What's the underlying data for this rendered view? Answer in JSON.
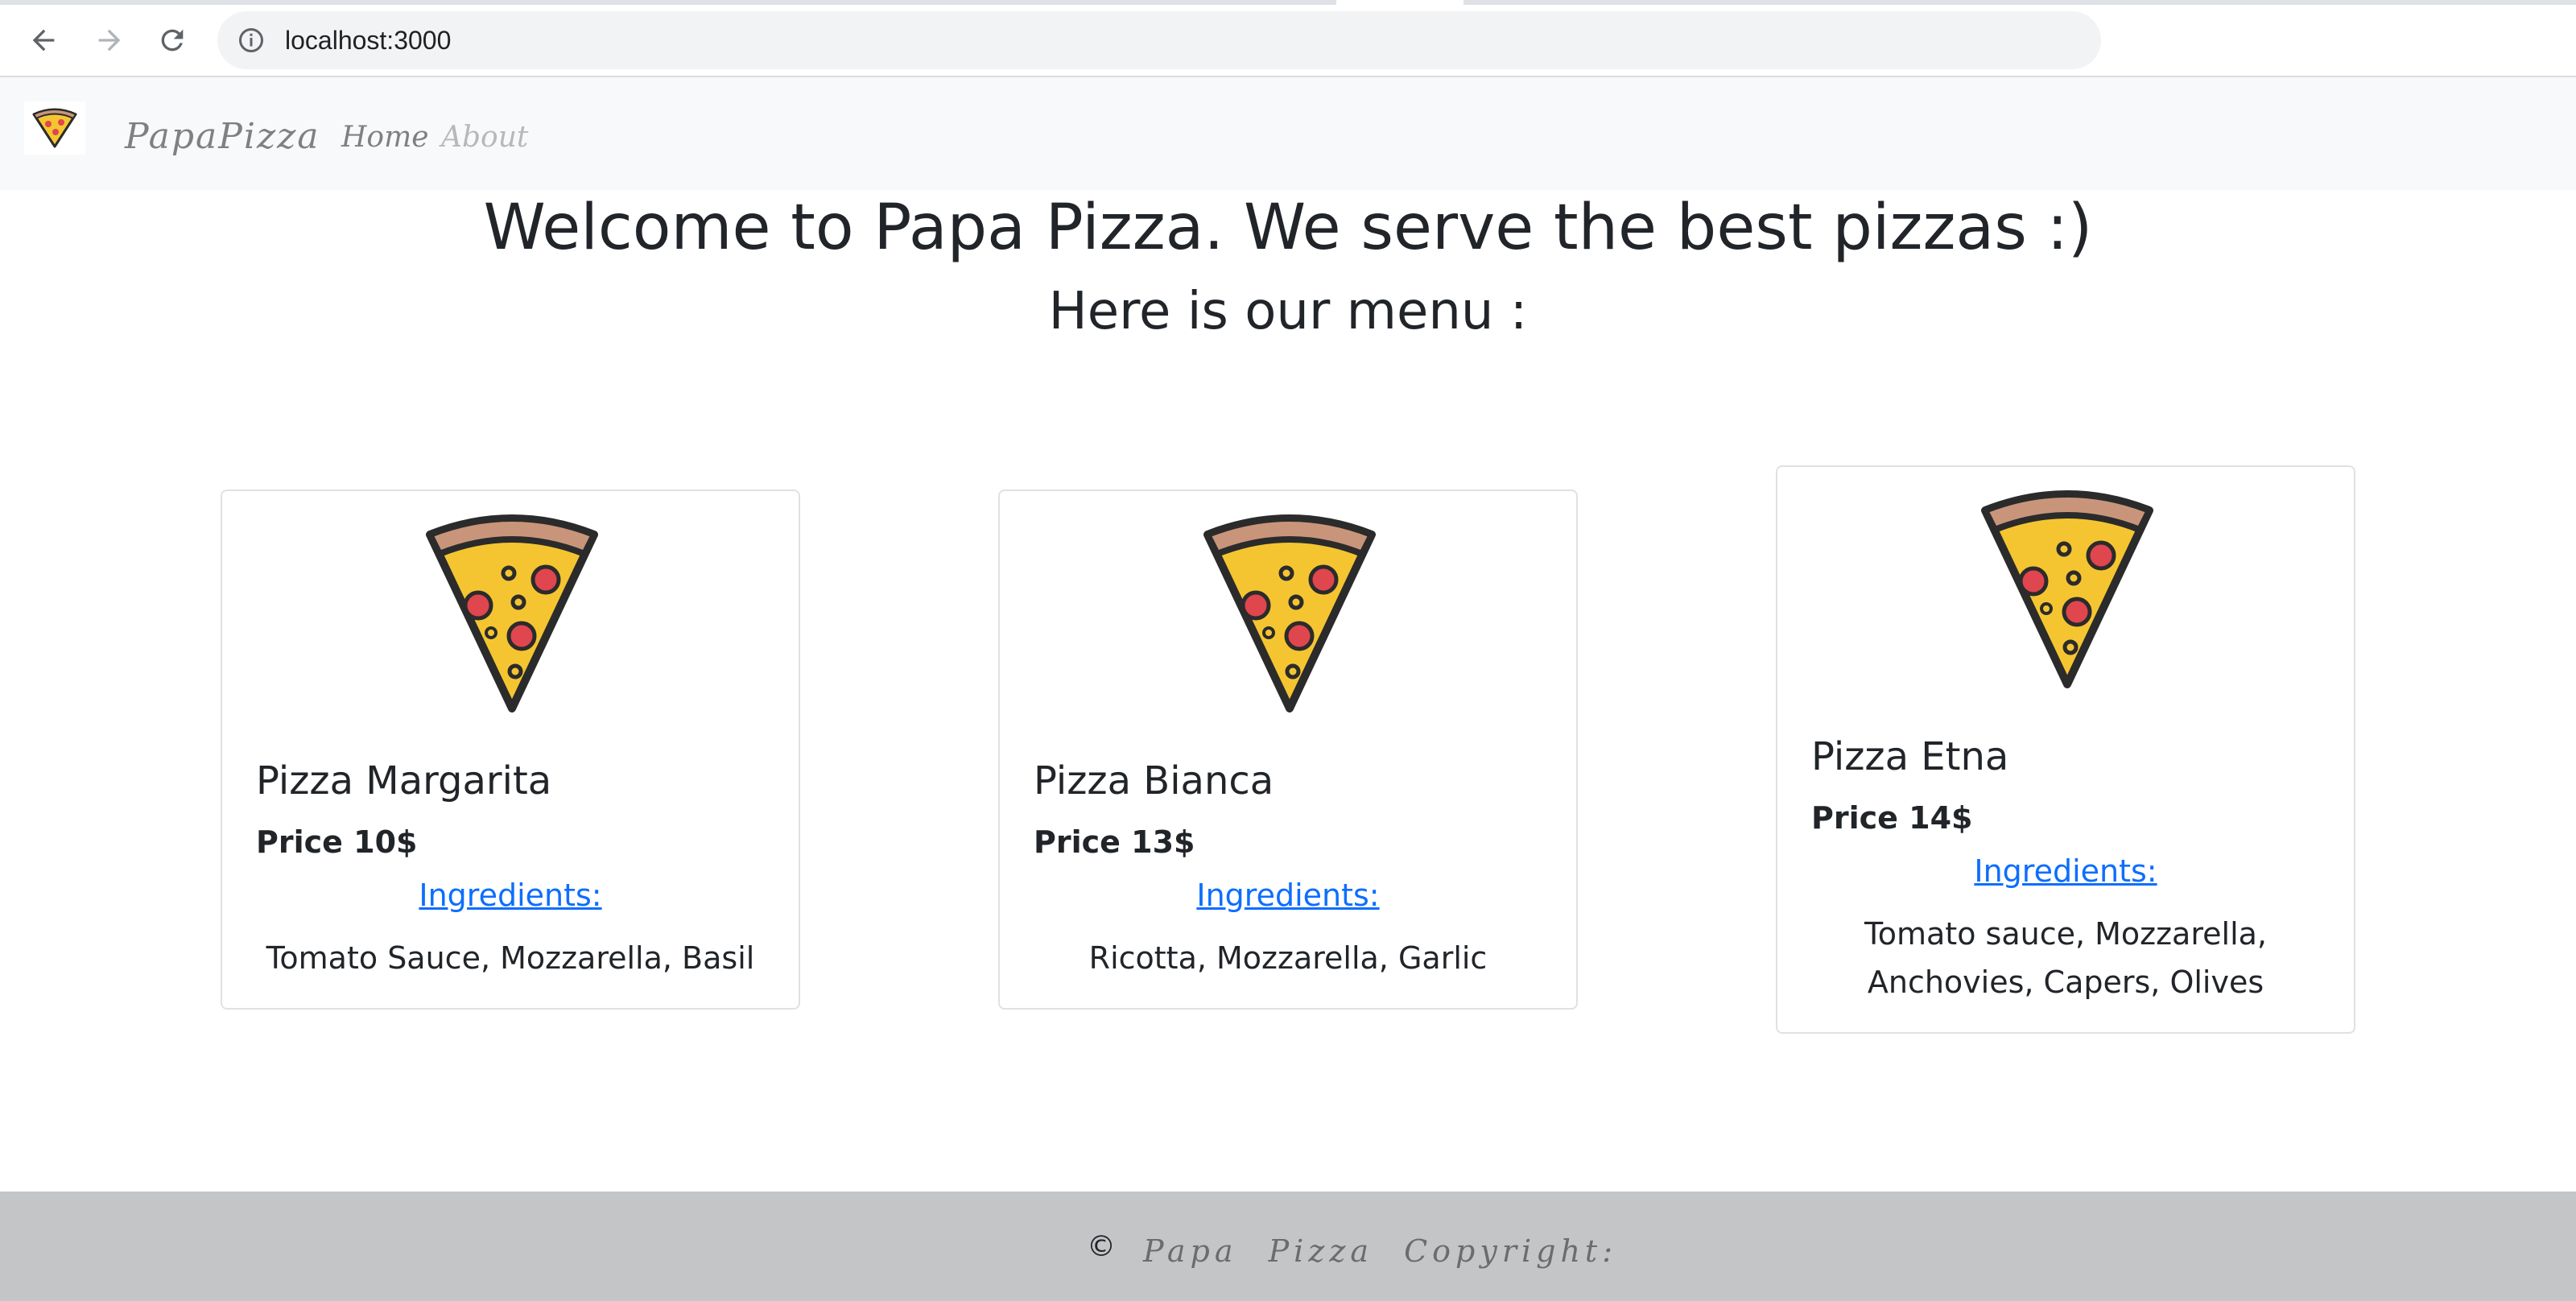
{
  "browser": {
    "url": "localhost:3000",
    "back_icon": "arrow-left-icon",
    "forward_icon": "arrow-right-icon",
    "reload_icon": "reload-icon",
    "info_icon": "info-icon"
  },
  "navbar": {
    "brand": "PapaPizza",
    "links": [
      "Home",
      "About"
    ],
    "logo_icon": "pizza-slice-icon",
    "background": "#f8f9fa"
  },
  "hero": {
    "title": "Welcome to Papa Pizza. We serve the best pizzas :)",
    "subtitle": "Here is our menu :"
  },
  "menu": [
    {
      "name": "Pizza Margarita",
      "price": "Price 10$",
      "ingredients_label": "Ingredients:",
      "ingredients": "Tomato Sauce, Mozzarella, Basil"
    },
    {
      "name": "Pizza Bianca",
      "price": "Price 13$",
      "ingredients_label": "Ingredients:",
      "ingredients": "Ricotta, Mozzarella, Garlic"
    },
    {
      "name": "Pizza Etna",
      "price": "Price 14$",
      "ingredients_label": "Ingredients:",
      "ingredients": "Tomato sauce, Mozzarella, Anchovies, Capers, Olives"
    }
  ],
  "footer": {
    "copyright_symbol": "©",
    "text": "Papa Pizza Copyright:",
    "background": "#c4c5c7"
  },
  "colors": {
    "link": "#0d6efd",
    "text": "#212529",
    "pizza_crust": "#c9957a",
    "pizza_cheese": "#f5c531",
    "pepperoni": "#e0464e",
    "outline": "#2b2b2b"
  }
}
